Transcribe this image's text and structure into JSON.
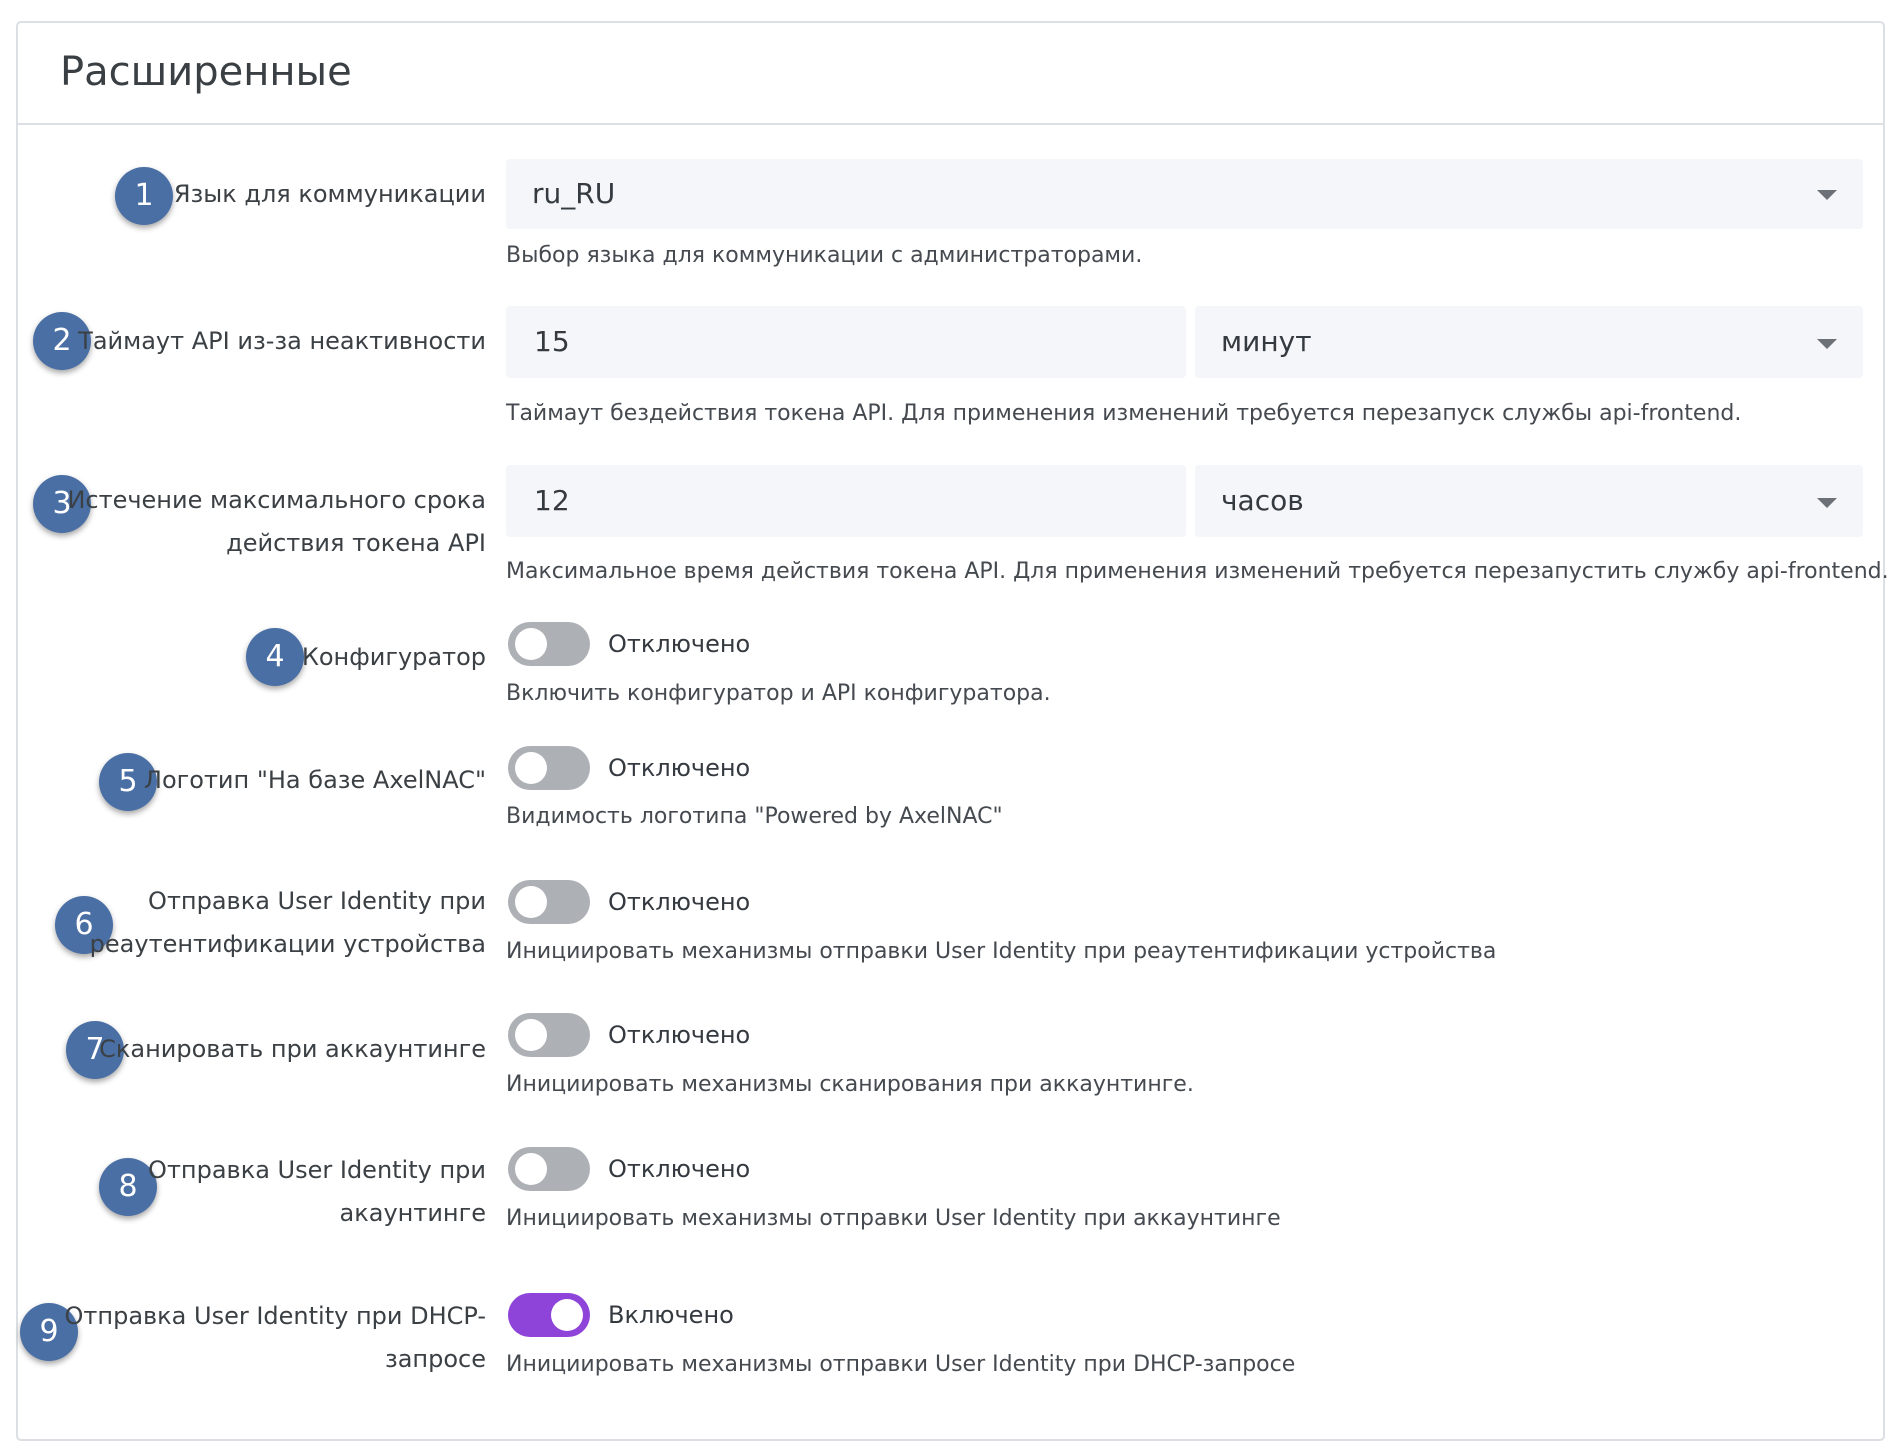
{
  "section": {
    "title": "Расширенные"
  },
  "rows": [
    {
      "num": "1",
      "label": "Язык для коммуникации",
      "value": "ru_RU",
      "help": "Выбор языка для коммуникации с администраторами."
    },
    {
      "num": "2",
      "label": "Таймаут API из-за неактивности",
      "value": "15",
      "unit": "минут",
      "help": "Таймаут бездействия токена API. Для применения изменений требуется перезапуск службы api-frontend."
    },
    {
      "num": "3",
      "label_line1": "Истечение максимального срока",
      "label_line2": "действия токена API",
      "value": "12",
      "unit": "часов",
      "help": "Максимальное время действия токена API. Для применения изменений требуется перезапустить службу api-frontend."
    },
    {
      "num": "4",
      "label": "Конфигуратор",
      "state": "Отключено",
      "enabled": false,
      "help": "Включить конфигуратор и API конфигуратора."
    },
    {
      "num": "5",
      "label": "Логотип \"На базе AxelNAC\"",
      "state": "Отключено",
      "enabled": false,
      "help": "Видимость логотипа \"Powered by AxelNAC\""
    },
    {
      "num": "6",
      "label_line1": "Отправка User Identity при",
      "label_line2": "реаутентификации устройства",
      "state": "Отключено",
      "enabled": false,
      "help": "Инициировать механизмы отправки User Identity при реаутентификации устройства"
    },
    {
      "num": "7",
      "label": "Сканировать при аккаунтинге",
      "state": "Отключено",
      "enabled": false,
      "help": "Инициировать механизмы сканирования при аккаунтинге."
    },
    {
      "num": "8",
      "label_line1": "Отправка User Identity при",
      "label_line2": "акаунтинге",
      "state": "Отключено",
      "enabled": false,
      "help": "Инициировать механизмы отправки User Identity при аккаунтинге"
    },
    {
      "num": "9",
      "label_line1": "Отправка User Identity при DHCP-",
      "label_line2": "запросе",
      "state": "Включено",
      "enabled": true,
      "help": "Инициировать механизмы отправки User Identity при DHCP-запросе"
    }
  ],
  "colors": {
    "badge": "#4a6fa5",
    "toggle_on": "#8e44d8",
    "toggle_off": "#adb1b6",
    "field_bg": "#f4f6f9"
  }
}
